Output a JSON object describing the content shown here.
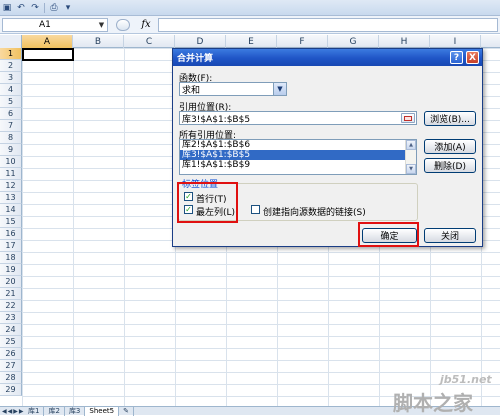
{
  "quick_access": {
    "icons": [
      "save-icon",
      "undo-icon",
      "redo-icon",
      "print-icon",
      "customize-icon"
    ]
  },
  "formula_bar": {
    "name_box": "A1",
    "fx_label": "fx",
    "formula": ""
  },
  "columns": [
    "A",
    "B",
    "C",
    "D",
    "E",
    "F",
    "G",
    "H",
    "I"
  ],
  "rows": [
    "1",
    "2",
    "3",
    "4",
    "5",
    "6",
    "7",
    "8",
    "9",
    "10",
    "11",
    "12",
    "13",
    "14",
    "15",
    "16",
    "17",
    "18",
    "19",
    "20",
    "21",
    "22",
    "23",
    "24",
    "25",
    "26",
    "27",
    "28",
    "29"
  ],
  "active_cell": "A1",
  "sheet_tabs": [
    "库1",
    "库2",
    "库3",
    "Sheet5"
  ],
  "active_sheet": "Sheet5",
  "dialog": {
    "title": "合并计算",
    "help_label": "?",
    "close_label": "X",
    "function_label": "函数(F):",
    "function_value": "求和",
    "ref_label": "引用位置(R):",
    "ref_value": "库3!$A$1:$B$5",
    "browse_label": "浏览(B)...",
    "all_refs_label": "所有引用位置:",
    "all_refs": [
      "库2!$A$1:$B$6",
      "库3!$A$1:$B$5",
      "库1!$A$1:$B$9"
    ],
    "selected_ref_index": 1,
    "add_label": "添加(A)",
    "delete_label": "删除(D)",
    "label_group_title": "标签位置",
    "top_row_label": "首行(T)",
    "top_row_checked": true,
    "left_col_label": "最左列(L)",
    "left_col_checked": true,
    "link_label": "创建指向源数据的链接(S)",
    "link_checked": false,
    "ok_label": "确定",
    "close_button_label": "关闭"
  },
  "highlight_color": "#e01010",
  "watermark": {
    "site": "jb51.net",
    "name": "脚本之家"
  }
}
